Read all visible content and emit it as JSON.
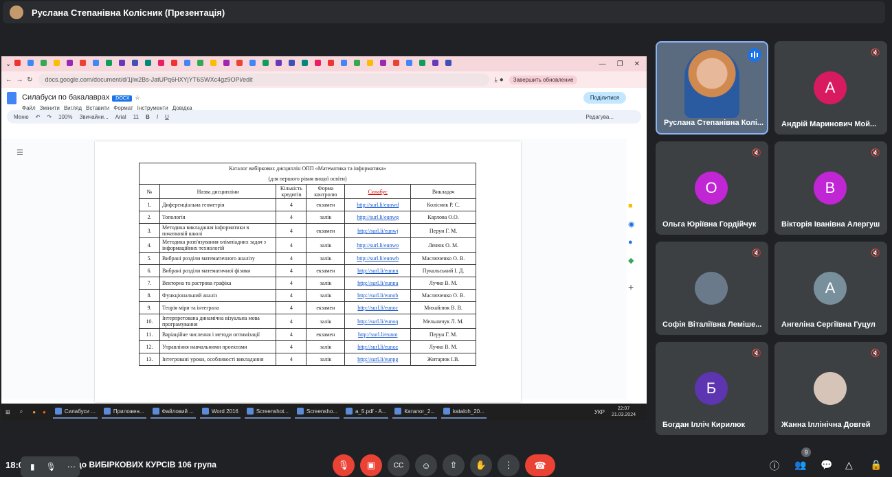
{
  "meeting": {
    "presenter_title": "Руслана Степанівна Колісник (Презентація)",
    "time": "18:07",
    "title_fragment": "одо ВИБІРКОВИХ КУРСІВ 106 група",
    "participants_count": "9"
  },
  "browser": {
    "url": "docs.google.com/document/d/1jlw2Bs-JatUPq6HXYjYT6SWXc4gz9OPi/edit",
    "update_label": "Завершить обновление"
  },
  "doc": {
    "title": "Силабуси по бакалаврах",
    "badge": ".DOCX",
    "menus": [
      "Файл",
      "Змінити",
      "Вигляд",
      "Вставити",
      "Формат",
      "Інструменти",
      "Довідка"
    ],
    "share_label": "Поділитися",
    "toolbar": {
      "menu": "Меню",
      "zoom": "100%",
      "style": "Звичайни...",
      "font": "Arial",
      "size": "11",
      "mode": "Редагува..."
    }
  },
  "table": {
    "caption1": "Каталог вибіркових дисциплін ОПП «Математика та інформатика»",
    "caption2": "(для першого рівня вищої освіти)",
    "headers": [
      "№",
      "Назва дисципліни",
      "Кількість кредитів",
      "Форма контролю",
      "Силабус",
      "Викладач"
    ],
    "rows": [
      [
        "1.",
        "Диференціальна геометрія",
        "4",
        "екзамен",
        "http://surl.li/eunwd",
        "Колісник Р. С."
      ],
      [
        "2.",
        "Топологія",
        "4",
        "залік",
        "http://surl.li/eunwg",
        "Карлова О.О."
      ],
      [
        "3.",
        "Методика викладання інформатики в початковій школі",
        "4",
        "екзамен",
        "http://surl.li/eunwj",
        "Перун Г. М."
      ],
      [
        "4.",
        "Методика розв'язування олімпіадних задач з інформаційних технологій",
        "4",
        "залік",
        "http://surl.li/eunwo",
        "Ленюк О. М."
      ],
      [
        "5.",
        "Вибрані розділи математичного аналізу",
        "4",
        "залік",
        "http://surl.li/eunwb",
        "Маслюченко О. В."
      ],
      [
        "6.",
        "Вибрані розділи математичної фізики",
        "4",
        "екзамен",
        "http://surl.li/eunnn",
        "Пукальський І. Д."
      ],
      [
        "7.",
        "Векторна та растрова графіка",
        "4",
        "залік",
        "http://surl.li/eunnu",
        "Лучко В. М."
      ],
      [
        "8.",
        "Функціональний аналіз",
        "4",
        "залік",
        "http://surl.li/eunob",
        "Маслюченко О. В."
      ],
      [
        "9.",
        "Теорія міри та інтеграла",
        "4",
        "екзамен",
        "http://surl.li/eunoc",
        "Михайлюк В. В."
      ],
      [
        "10.",
        "Інтерпретована динамічна візуальна мова програмування",
        "4",
        "залік",
        "http://surl.li/eunoq",
        "Мельничук Л. М."
      ],
      [
        "11.",
        "Варіаційне числення і методи оптимізації",
        "4",
        "екзамен",
        "http://surl.li/eunot",
        "Перун Г. М."
      ],
      [
        "12.",
        "Управління навчальними проектами",
        "4",
        "залік",
        "http://surl.li/eunoz",
        "Лучко В. М."
      ],
      [
        "13.",
        "Інтегровані уроки, особливості викладання",
        "4",
        "залік",
        "http://surl.li/eunpg",
        "Житарюк І.В."
      ]
    ]
  },
  "taskbar": {
    "items": [
      "Силабуси ...",
      "Приложен...",
      "Файловий ...",
      "Word 2016",
      "Screenshot...",
      "Screensho...",
      "a_5.pdf - A...",
      "Каталог_2...",
      "kataloh_20..."
    ],
    "lang": "УКР",
    "clock": "22:07",
    "date": "21.03.2024"
  },
  "tiles": [
    {
      "name": "Руслана Степанівна Колі...",
      "letter": "",
      "color": "#3a5a8c"
    },
    {
      "name": "Андрій Маринович Мой...",
      "letter": "А",
      "color": "#d81b60"
    },
    {
      "name": "Ольга Юріївна Гордійчук",
      "letter": "О",
      "color": "#c026d3"
    },
    {
      "name": "Вікторія Іванівна Алергуш",
      "letter": "В",
      "color": "#c026d3"
    },
    {
      "name": "Софія Віталіївна Леміше...",
      "letter": "",
      "color": "#6b7a8a"
    },
    {
      "name": "Ангеліна Сергіївна Гуцул",
      "letter": "А",
      "color": "#78909c"
    },
    {
      "name": "Богдан Ілліч Кирилюк",
      "letter": "Б",
      "color": "#5e35b1"
    },
    {
      "name": "Жанна Іллінічна Довгей",
      "letter": "",
      "color": "#d7c4b8"
    }
  ]
}
